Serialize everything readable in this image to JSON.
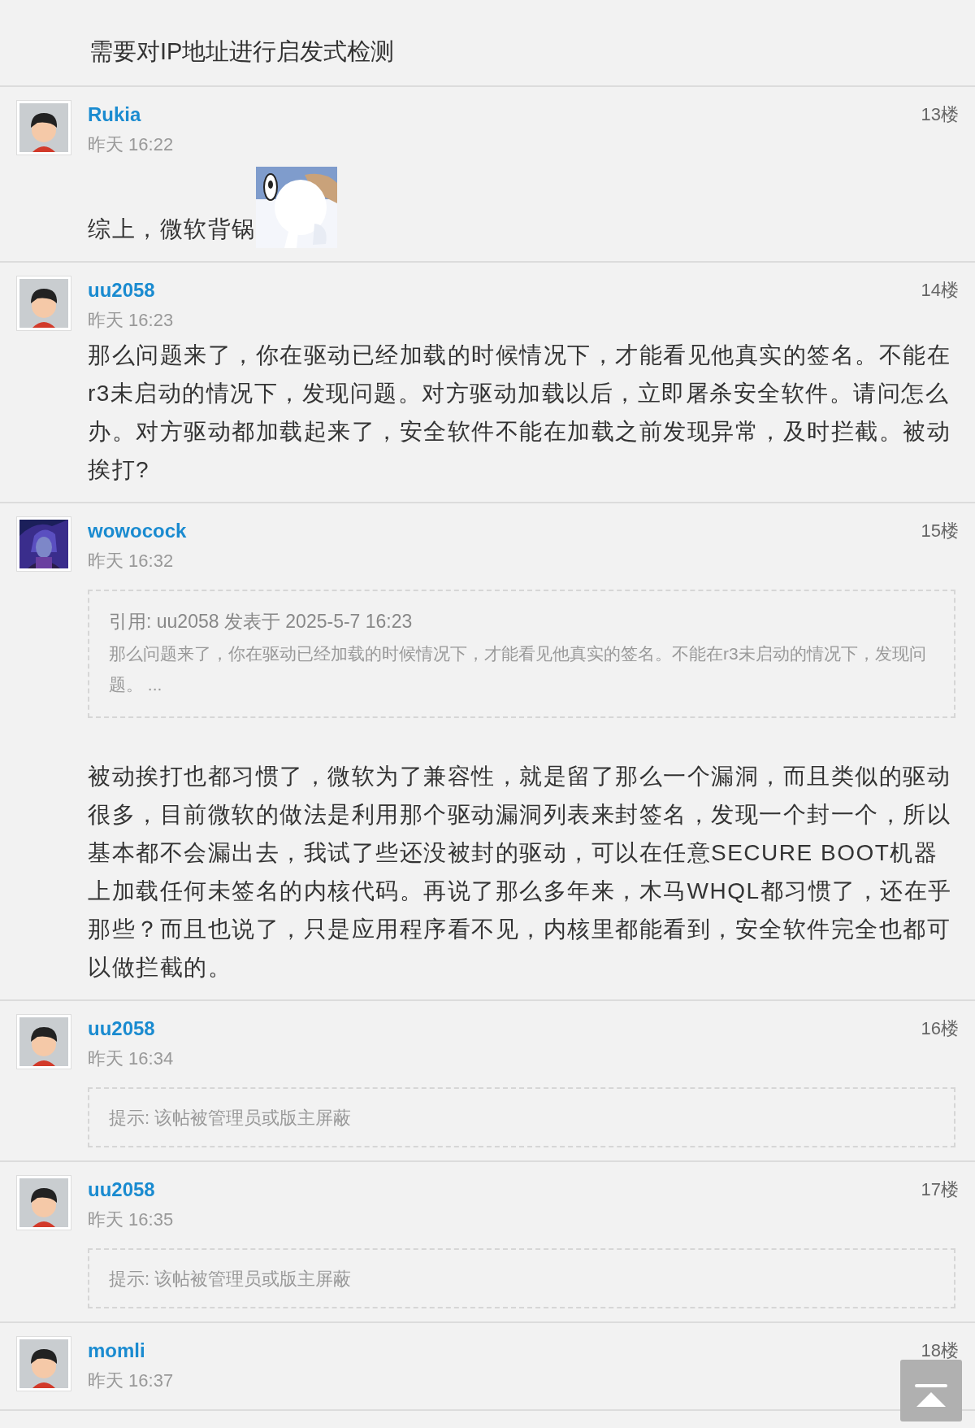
{
  "topic_text": "需要对IP地址进行启发式检测",
  "posts": [
    {
      "author": "Rukia",
      "time": "昨天 16:22",
      "floor": "13楼",
      "avatar": {
        "kind": "cartoon"
      },
      "blocks": [
        {
          "kind": "text",
          "text": "综上，微软背锅"
        },
        {
          "kind": "picture"
        }
      ]
    },
    {
      "author": "uu2058",
      "time": "昨天 16:23",
      "floor": "14楼",
      "avatar": {
        "kind": "cartoon"
      },
      "blocks": [
        {
          "kind": "text",
          "text": "那么问题来了，你在驱动已经加载的时候情况下，才能看见他真实的签名。不能在r3未启动的情况下，发现问题。对方驱动加载以后，立即屠杀安全软件。请问怎么办。对方驱动都加载起来了，安全软件不能在加载之前发现异常，及时拦截。被动挨打?"
        }
      ]
    },
    {
      "author": "wowocock",
      "time": "昨天 16:32",
      "floor": "15楼",
      "avatar": {
        "kind": "picture"
      },
      "blocks": [
        {
          "kind": "quote",
          "heading": "引用: uu2058 发表于 2025-5-7 16:23",
          "text": "那么问题来了，你在驱动已经加载的时候情况下，才能看见他真实的签名。不能在r3未启动的情况下，发现问题。 ..."
        },
        {
          "kind": "text",
          "text": "被动挨打也都习惯了，微软为了兼容性，就是留了那么一个漏洞，而且类似的驱动很多，目前微软的做法是利用那个驱动漏洞列表来封签名，发现一个封一个，所以基本都不会漏出去，我试了些还没被封的驱动，可以在任意SECURE BOOT机器上加载任何未签名的内核代码。再说了那么多年来，木马WHQL都习惯了，还在乎那些？而且也说了，只是应用程序看不见，内核里都能看到，安全软件完全也都可以做拦截的。"
        }
      ]
    },
    {
      "author": "uu2058",
      "time": "昨天 16:34",
      "floor": "16楼",
      "avatar": {
        "kind": "cartoon"
      },
      "blocks": [
        {
          "kind": "notice",
          "text": "提示: 该帖被管理员或版主屏蔽"
        }
      ]
    },
    {
      "author": "uu2058",
      "time": "昨天 16:35",
      "floor": "17楼",
      "avatar": {
        "kind": "cartoon"
      },
      "blocks": [
        {
          "kind": "notice",
          "text": "提示: 该帖被管理员或版主屏蔽"
        }
      ]
    },
    {
      "author": "momli",
      "time": "昨天 16:37",
      "floor": "18楼",
      "avatar": {
        "kind": "cartoon"
      }
    }
  ]
}
